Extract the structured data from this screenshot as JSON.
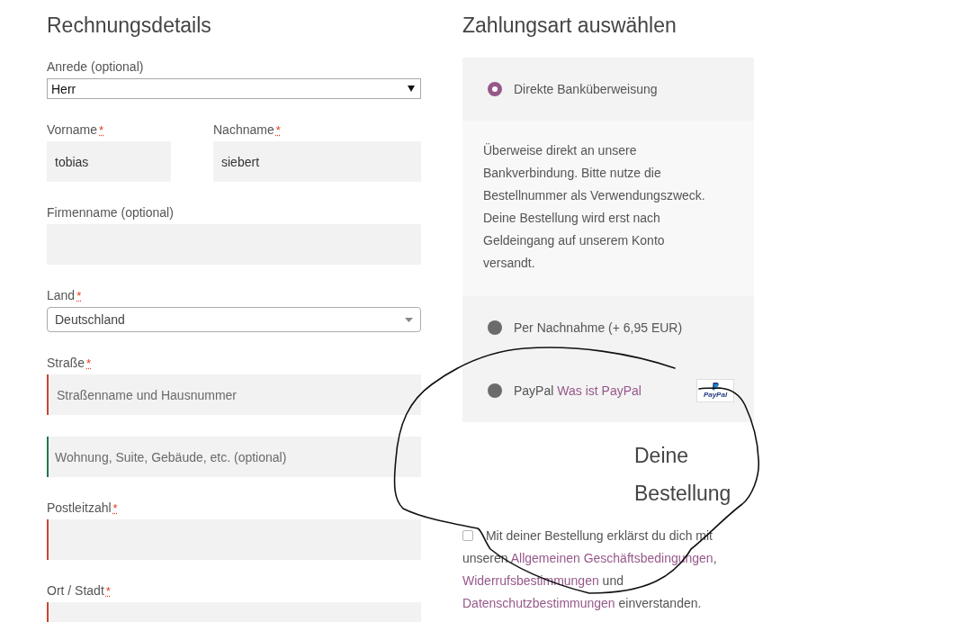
{
  "billing": {
    "title": "Rechnungsdetails",
    "rows": [
      {
        "fields": [
          {
            "kind": "select",
            "label": "Anrede (optional)",
            "value": "Herr",
            "invalid": false,
            "valid": false
          }
        ]
      },
      {
        "fields": [
          {
            "kind": "text",
            "label": "Vorname",
            "required_mark": "*",
            "value": "tobias",
            "invalid": false,
            "valid": false
          },
          {
            "kind": "text",
            "label": "Nachname",
            "required_mark": "*",
            "value": "siebert",
            "invalid": false,
            "valid": false
          }
        ]
      },
      {
        "fields": [
          {
            "kind": "text",
            "label": "Firmenname (optional)",
            "invalid": false,
            "valid": false
          }
        ]
      },
      {
        "fields": [
          {
            "kind": "combobox",
            "label": "Land",
            "required_mark": "*",
            "value": "Deutschland",
            "invalid": false,
            "valid": false
          }
        ]
      },
      {
        "fields": [
          {
            "kind": "text",
            "label": "Straße",
            "required_mark": "*",
            "placeholder": "Straßenname und Hausnummer",
            "invalid": true,
            "valid": false
          }
        ]
      },
      {
        "fields": [
          {
            "kind": "text",
            "placeholder": "Wohnung, Suite, Gebäude, etc. (optional)",
            "invalid": false,
            "valid": true
          }
        ]
      },
      {
        "fields": [
          {
            "kind": "text",
            "label": "Postleitzahl",
            "required_mark": "*",
            "invalid": true,
            "valid": false
          }
        ]
      },
      {
        "fields": [
          {
            "kind": "text",
            "label": "Ort / Stadt",
            "required_mark": "*",
            "invalid": true,
            "valid": false
          }
        ]
      }
    ]
  },
  "payment": {
    "title": "Zahlungsart auswählen",
    "methods": [
      {
        "label": "Direkte Banküberweisung",
        "selected": true,
        "description": "Überweise direkt an unsere Bankverbindung. Bitte nutze die Bestellnummer als Verwendungszweck. Deine Bestellung wird erst nach Geldeingang auf unserem Konto versandt."
      },
      {
        "label": "Per Nachnahme (+ 6,95 EUR)",
        "selected": false
      },
      {
        "label": "PayPal",
        "link": "Was ist PayPal",
        "logo_text": "PayPal",
        "selected": false
      }
    ]
  },
  "order": {
    "title": "Deine Bestellung"
  },
  "terms": {
    "checked": false,
    "parts": [
      {
        "kind": "text",
        "text": "Mit deiner Bestellung erklärst du dich mit unseren "
      },
      {
        "kind": "link",
        "text": "Allgemeinen Geschäftsbedingungen"
      },
      {
        "kind": "text",
        "text": ", "
      },
      {
        "kind": "link",
        "text": "Widerrufsbestimmungen"
      },
      {
        "kind": "text",
        "text": " und "
      },
      {
        "kind": "link",
        "text": "Datenschutzbestimmungen"
      },
      {
        "kind": "text",
        "text": " einverstanden."
      }
    ]
  },
  "annotation": {
    "kind": "freehand-loop"
  }
}
